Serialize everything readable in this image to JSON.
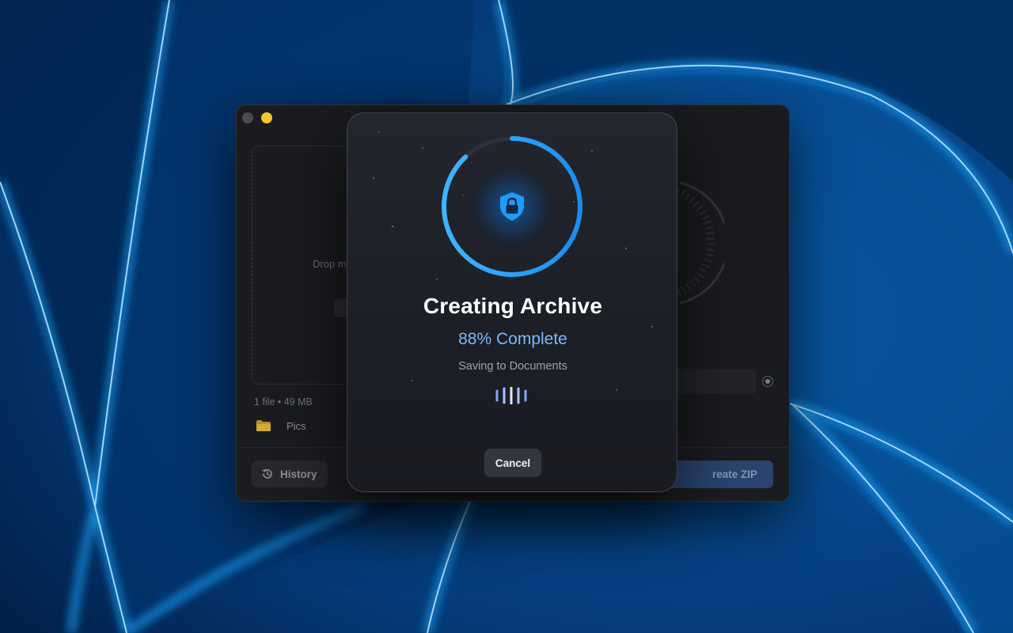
{
  "colors": {
    "accent": "#1e9cff",
    "percent_text": "#7cb8ff",
    "window_bg": "#1a1b1e",
    "folder": "#d4a83a",
    "traffic_minimize": "#f6c531"
  },
  "window": {
    "traffic_lights": [
      "close",
      "minimize"
    ],
    "drop_zone": {
      "text": "Drop m"
    },
    "file_info": "1 file • 49 MB",
    "destination_folder": {
      "icon": "folder-icon",
      "label": "Pics"
    },
    "footer": {
      "history_label": "History",
      "history_icon": "clock-history-icon",
      "create_label": "reate ZIP"
    }
  },
  "modal": {
    "icon": "shield-lock-icon",
    "progress": 0.88,
    "title": "Creating Archive",
    "percent_text": "88% Complete",
    "subtitle": "Saving to Documents",
    "activity_icon": "activity-bars-icon",
    "cancel_label": "Cancel"
  }
}
